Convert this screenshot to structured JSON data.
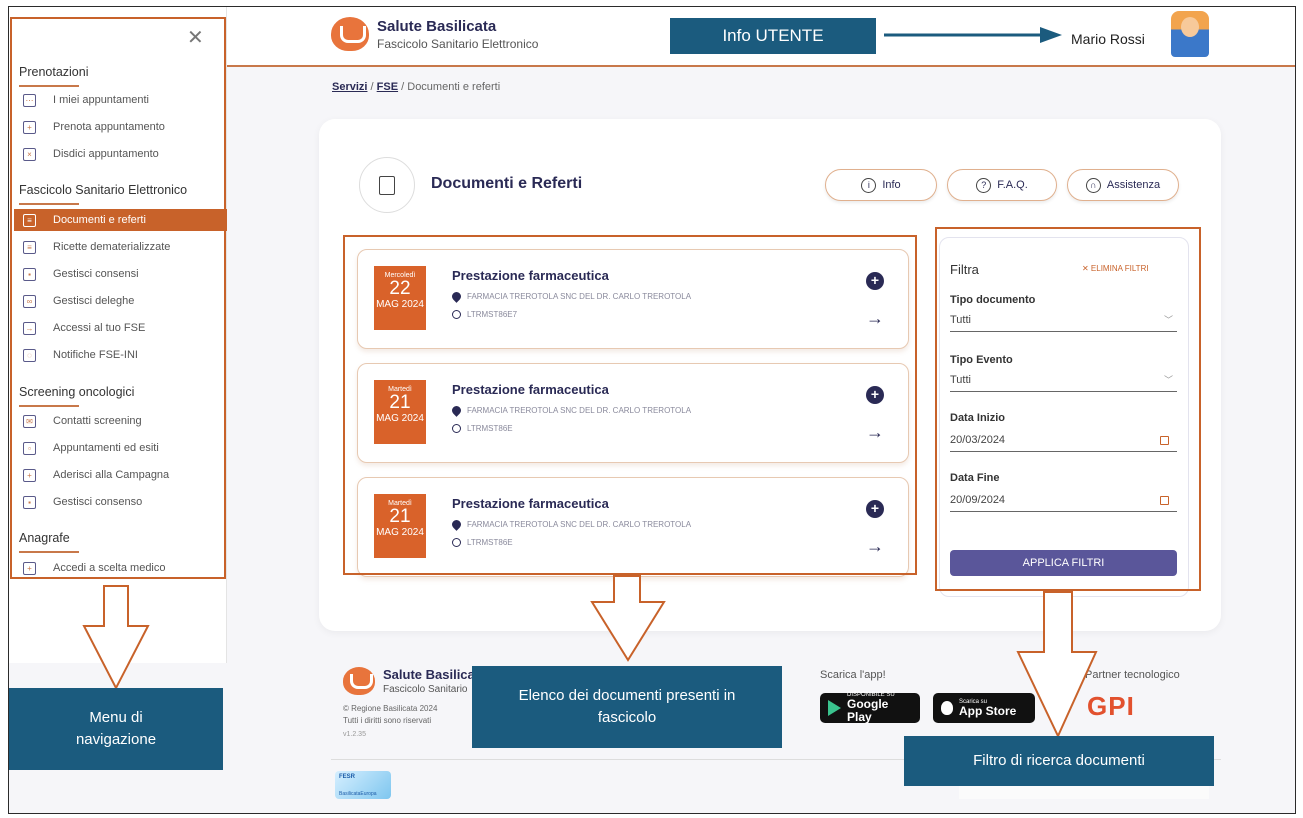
{
  "header": {
    "app_title": "Salute Basilicata",
    "app_subtitle": "Fascicolo Sanitario Elettronico",
    "user_name": "Mario Rossi"
  },
  "sidebar": {
    "close_icon": "close-icon",
    "sections": [
      {
        "title": "Prenotazioni"
      },
      {
        "title": "Fascicolo Sanitario Elettronico"
      },
      {
        "title": "Screening oncologici"
      },
      {
        "title": "Anagrafe"
      }
    ],
    "items": [
      {
        "label": "I miei appuntamenti",
        "icon": "calendar-icon"
      },
      {
        "label": "Prenota appuntamento",
        "icon": "calendar-plus-icon"
      },
      {
        "label": "Disdici appuntamento",
        "icon": "calendar-x-icon"
      },
      {
        "label": "Documenti e referti",
        "icon": "document-icon"
      },
      {
        "label": "Ricette dematerializzate",
        "icon": "prescription-icon"
      },
      {
        "label": "Gestisci consensi",
        "icon": "lock-icon"
      },
      {
        "label": "Gestisci deleghe",
        "icon": "people-icon"
      },
      {
        "label": "Accessi al tuo FSE",
        "icon": "login-icon"
      },
      {
        "label": "Notifiche FSE-INI",
        "icon": "bell-icon"
      },
      {
        "label": "Contatti screening",
        "icon": "phone-mail-icon"
      },
      {
        "label": "Appuntamenti ed esiti",
        "icon": "calendar-icon"
      },
      {
        "label": "Aderisci alla Campagna",
        "icon": "person-plus-icon"
      },
      {
        "label": "Gestisci consenso",
        "icon": "lock-icon"
      },
      {
        "label": "Accedi a scelta medico",
        "icon": "person-plus-icon"
      }
    ],
    "active_item": "Documenti e referti"
  },
  "breadcrumb": {
    "servizi": "Servizi",
    "fse": "FSE",
    "sep": "/",
    "current": "Documenti e referti"
  },
  "page": {
    "title": "Documenti e Referti",
    "buttons": {
      "info": "Info",
      "faq": "F.A.Q.",
      "assistenza": "Assistenza"
    }
  },
  "documents": [
    {
      "weekday": "Mercoledì",
      "day": "22",
      "month_year": "MAG 2024",
      "title": "Prestazione farmaceutica",
      "place": "FARMACIA TREROTOLA SNC DEL DR. CARLO TREROTOLA",
      "code": "LTRMST86E7"
    },
    {
      "weekday": "Martedì",
      "day": "21",
      "month_year": "MAG 2024",
      "title": "Prestazione farmaceutica",
      "place": "FARMACIA TREROTOLA SNC DEL DR. CARLO TREROTOLA",
      "code": "LTRMST86E"
    },
    {
      "weekday": "Martedì",
      "day": "21",
      "month_year": "MAG 2024",
      "title": "Prestazione farmaceutica",
      "place": "FARMACIA TREROTOLA SNC DEL DR. CARLO TREROTOLA",
      "code": "LTRMST86E"
    }
  ],
  "filter": {
    "title": "Filtra",
    "clear_label": "✕ ELIMINA FILTRI",
    "tipo_documento_label": "Tipo documento",
    "tipo_documento_value": "Tutti",
    "tipo_evento_label": "Tipo Evento",
    "tipo_evento_value": "Tutti",
    "data_inizio_label": "Data Inizio",
    "data_inizio_value": "20/03/2024",
    "data_fine_label": "Data Fine",
    "data_fine_value": "20/09/2024",
    "apply_label": "APPLICA FILTRI"
  },
  "footer": {
    "brand_title": "Salute Basilica",
    "brand_subtitle": "Fascicolo Sanitario",
    "copyright_1": "© Regione Basilicata 2024",
    "copyright_2": "Tutti i diritti sono riservati",
    "version": "v1.2.35",
    "download_label": "Scarica l'app!",
    "partner_label": "Partner tecnologico",
    "google_small": "DISPONIBILE SU",
    "google_big": "Google Play",
    "apple_small": "Scarica su",
    "apple_big": "App Store",
    "partner_logo": "GPI",
    "fesr_top": "FESR",
    "fesr_bottom": "BasilicataEuropa"
  },
  "annotations": {
    "info_utente": "Info UTENTE",
    "menu": "Menu di navigazione",
    "elenco": "Elenco dei documenti presenti in fascicolo",
    "filtro": "Filtro di ricerca documenti"
  },
  "colors": {
    "accent": "#c8622a",
    "navy": "#2a2a55",
    "callout_bg": "#1b5b7e",
    "apply_button": "#5a569a"
  }
}
